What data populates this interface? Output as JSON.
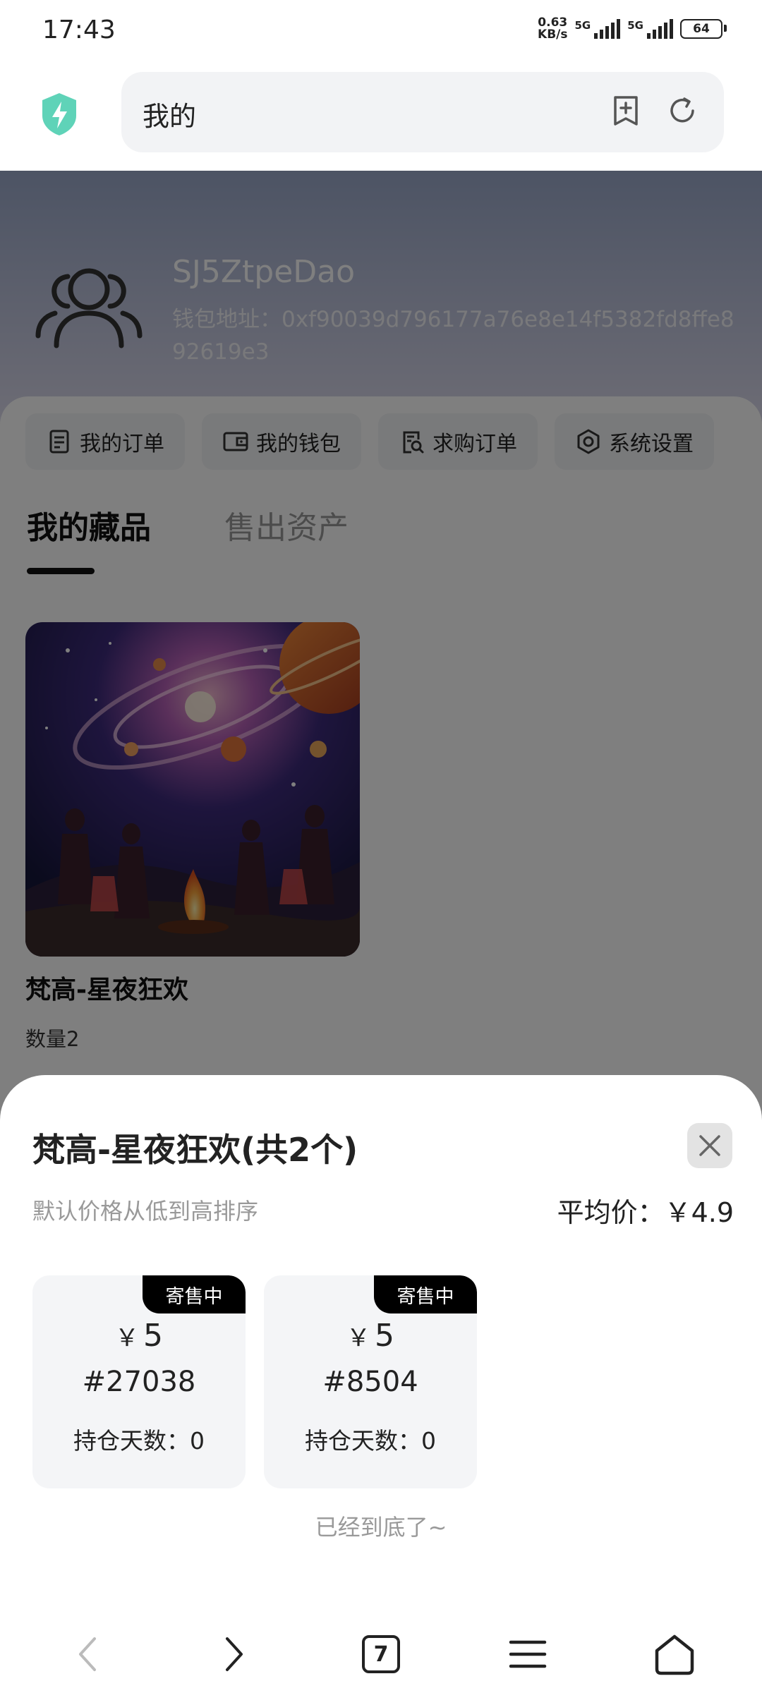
{
  "status": {
    "time": "17:43",
    "net_speed_top": "0.63",
    "net_speed_bottom": "KB/s",
    "sim1": "5G",
    "sim2": "5G",
    "battery": "64"
  },
  "browser": {
    "url_title": "我的"
  },
  "profile": {
    "username": "SJ5ZtpeDao",
    "wallet_address": "钱包地址：0xf90039d796177a76e8e14f5382fd8ffe892619e3"
  },
  "quick_menu": [
    {
      "label": "我的订单",
      "icon": "order-icon"
    },
    {
      "label": "我的钱包",
      "icon": "wallet-icon"
    },
    {
      "label": "求购订单",
      "icon": "purchase-order-icon"
    },
    {
      "label": "系统设置",
      "icon": "settings-icon"
    }
  ],
  "tabs": [
    {
      "label": "我的藏品",
      "active": true
    },
    {
      "label": "售出资产",
      "active": false
    }
  ],
  "collection": {
    "name": "梵高-星夜狂欢",
    "quantity": "数量2"
  },
  "sheet": {
    "title": "梵高-星夜狂欢(共2个)",
    "sort_hint": "默认价格从低到高排序",
    "avg_price": "平均价：￥4.9",
    "items": [
      {
        "badge": "寄售中",
        "currency": "￥",
        "price": "5",
        "serial": "#27038",
        "days": "持仓天数：0"
      },
      {
        "badge": "寄售中",
        "currency": "￥",
        "price": "5",
        "serial": "#8504",
        "days": "持仓天数：0"
      }
    ],
    "end_text": "已经到底了~"
  },
  "nav": {
    "tab_count": "7"
  }
}
